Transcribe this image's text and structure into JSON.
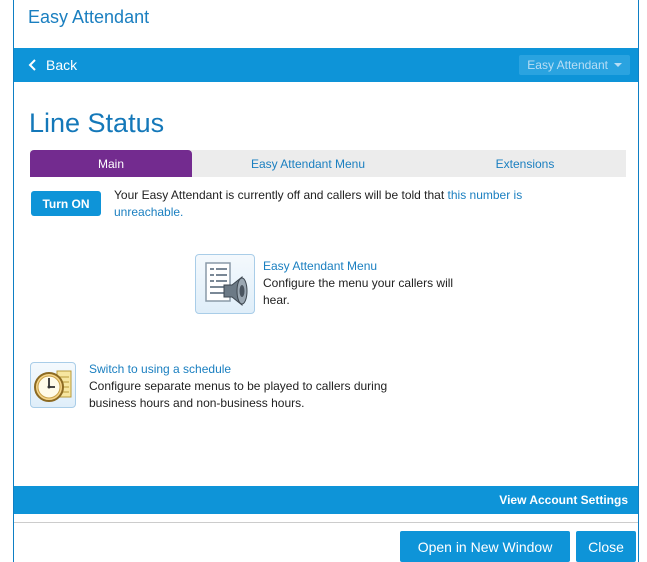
{
  "window": {
    "title": "Easy Attendant"
  },
  "nav": {
    "back_label": "Back",
    "app_dropdown_label": "Easy Attendant"
  },
  "page": {
    "title": "Line Status"
  },
  "tabs": [
    {
      "label": "Main",
      "active": true
    },
    {
      "label": "Easy Attendant Menu",
      "active": false
    },
    {
      "label": "Extensions",
      "active": false
    }
  ],
  "status": {
    "button_label": "Turn ON",
    "text": "Your Easy Attendant is currently off and callers will be told that ",
    "link_text": "this number is unreachable."
  },
  "features": {
    "menu": {
      "icon": "menu-speaker-icon",
      "link": "Easy Attendant Menu",
      "description": "Configure the menu your callers will hear."
    },
    "schedule": {
      "icon": "clock-schedule-icon",
      "link": "Switch to using a schedule",
      "description": "Configure separate menus to be played to callers during business hours and non-business hours."
    }
  },
  "footer": {
    "account_link": "View Account Settings",
    "open_window_label": "Open in New Window",
    "close_label": "Close"
  },
  "colors": {
    "accent_blue": "#0e94d8",
    "tab_active_purple": "#732b8f",
    "title_blue": "#1478b9"
  }
}
